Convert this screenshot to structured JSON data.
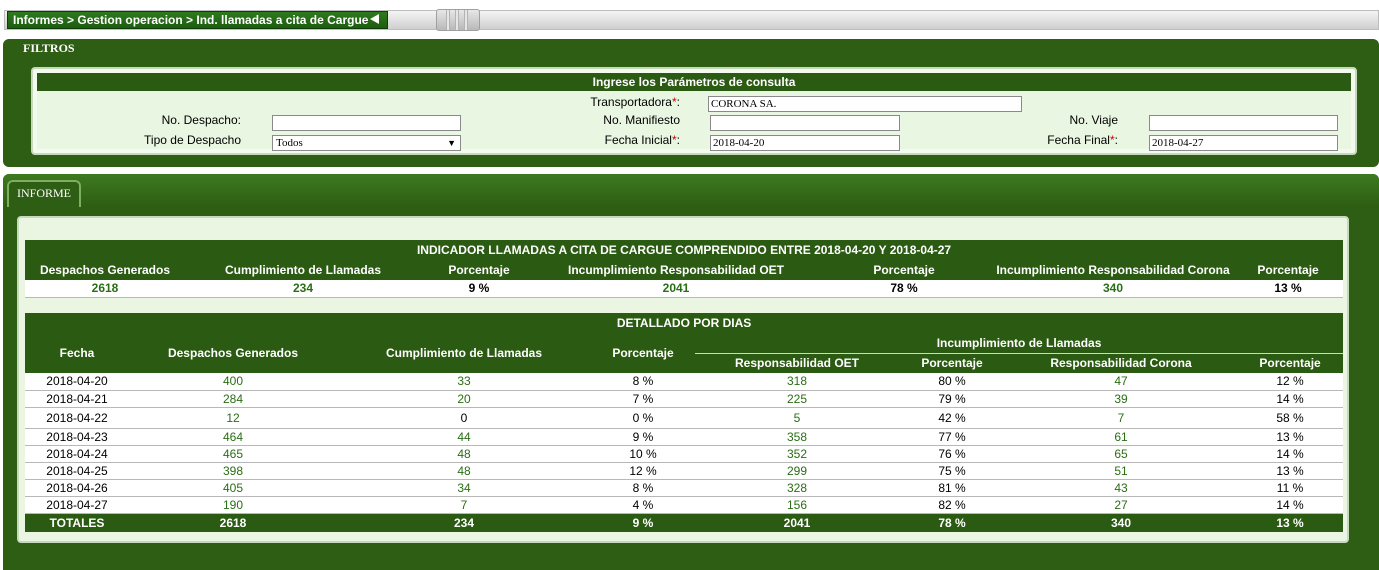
{
  "breadcrumb": {
    "text": "Informes > Gestion operacion > Ind. llamadas a cita de Cargue"
  },
  "filtros": {
    "title": "FILTROS",
    "header": "Ingrese los Parámetros de consulta",
    "transportadora_label": "Transportadora",
    "transportadora_value": "CORONA SA.",
    "no_despacho_label": "No. Despacho:",
    "no_despacho_value": "",
    "no_manifiesto_label": "No. Manifiesto",
    "no_manifiesto_value": "",
    "no_viaje_label": "No. Viaje",
    "no_viaje_value": "",
    "tipo_despacho_label": "Tipo de Despacho",
    "tipo_despacho_value": "Todos",
    "fecha_inicial_label": "Fecha Inicial",
    "fecha_inicial_value": "2018-04-20",
    "fecha_final_label": "Fecha Final",
    "fecha_final_value": "2018-04-27",
    "required_mark": "*",
    "colon": ":"
  },
  "informe": {
    "tab_label": "INFORME",
    "summary": {
      "caption": "INDICADOR LLAMADAS A CITA DE CARGUE COMPRENDIDO ENTRE 2018-04-20 Y 2018-04-27",
      "headers": [
        "Despachos Generados",
        "Cumplimiento de Llamadas",
        "Porcentaje",
        "Incumplimiento Responsabilidad OET",
        "Porcentaje",
        "Incumplimiento Responsabilidad Corona",
        "Porcentaje"
      ],
      "values": [
        "2618",
        "234",
        "9 %",
        "2041",
        "78 %",
        "340",
        "13 %"
      ]
    },
    "detail": {
      "caption": "DETALLADO POR DIAS",
      "h_fecha": "Fecha",
      "h_despachos": "Despachos Generados",
      "h_cumplimiento": "Cumplimiento de Llamadas",
      "h_porcentaje": "Porcentaje",
      "h_incumplimiento": "Incumplimiento de Llamadas",
      "h_resp_oet": "Responsabilidad OET",
      "h_porc_oet": "Porcentaje",
      "h_resp_corona": "Responsabilidad Corona",
      "h_porc_corona": "Porcentaje",
      "rows": [
        [
          "2018-04-20",
          "400",
          "33",
          "8 %",
          "318",
          "80 %",
          "47",
          "12 %"
        ],
        [
          "2018-04-21",
          "284",
          "20",
          "7 %",
          "225",
          "79 %",
          "39",
          "14 %"
        ],
        [
          "2018-04-22",
          "12",
          "0",
          "0 %",
          "5",
          "42 %",
          "7",
          "58 %"
        ],
        [
          "2018-04-23",
          "464",
          "44",
          "9 %",
          "358",
          "77 %",
          "61",
          "13 %"
        ],
        [
          "2018-04-24",
          "465",
          "48",
          "10 %",
          "352",
          "76 %",
          "65",
          "14 %"
        ],
        [
          "2018-04-25",
          "398",
          "48",
          "12 %",
          "299",
          "75 %",
          "51",
          "13 %"
        ],
        [
          "2018-04-26",
          "405",
          "34",
          "8 %",
          "328",
          "81 %",
          "43",
          "11 %"
        ],
        [
          "2018-04-27",
          "190",
          "7",
          "4 %",
          "156",
          "82 %",
          "27",
          "14 %"
        ]
      ],
      "totals": [
        "TOTALES",
        "2618",
        "234",
        "9 %",
        "2041",
        "78 %",
        "340",
        "13 %"
      ]
    }
  },
  "colors": {
    "panel_green": "#2e5e14",
    "header_green": "#2b5a12",
    "value_green": "#2a6e14",
    "required_red": "#cc0000"
  },
  "icons": {
    "breadcrumb_collapse": "triangle-left-icon",
    "select_arrow": "chevron-down-icon"
  }
}
